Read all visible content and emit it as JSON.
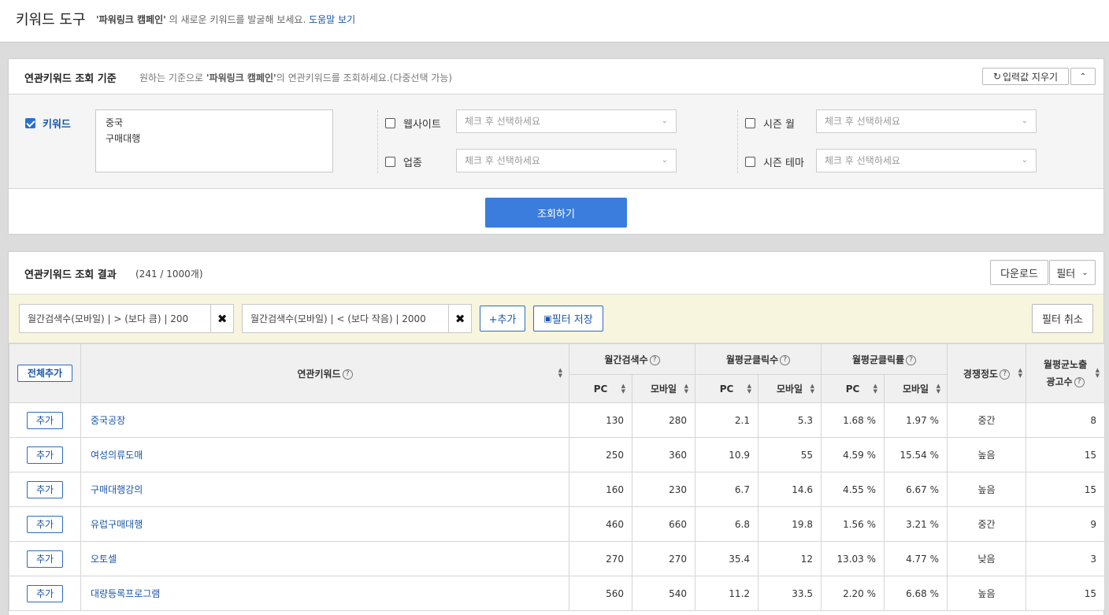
{
  "header": {
    "title": "키워드 도구",
    "desc_campaign": "'파워링크 캠페인'",
    "desc_text": " 의 새로운 키워드를 발굴해 보세요.",
    "help_link": "도움말 보기"
  },
  "criteria": {
    "title": "연관키워드 조회 기준",
    "sub_prefix": "원하는 기준으로 ",
    "sub_campaign": "'파워링크 캠페인'",
    "sub_suffix": "의 연관키워드를 조회하세요.(다중선택 가능)",
    "reset_label": "입력값 지우기",
    "collapse_icon": "chevron-up",
    "keyword_label": "키워드",
    "keyword_checked": true,
    "keywords": [
      "중국",
      "구매대행"
    ],
    "website_label": "웹사이트",
    "industry_label": "업종",
    "season_month_label": "시즌 월",
    "season_theme_label": "시즌 테마",
    "select_placeholder": "체크 후 선택하세요",
    "submit_label": "조회하기"
  },
  "results": {
    "title": "연관키워드 조회 결과",
    "count": "(241 / 1000개)",
    "download_label": "다운로드",
    "filter_label": "필터",
    "filters": [
      "월간검색수(모바일) | > (보다 큼) | 200",
      "월간검색수(모바일) | < (보다 작음) | 2000"
    ],
    "add_filter_label": "+추가",
    "save_filter_label": "필터 저장",
    "cancel_filter_label": "필터 취소",
    "columns": {
      "add_all": "전체추가",
      "keyword": "연관키워드",
      "monthly_search": "월간검색수",
      "avg_clicks": "월평균클릭수",
      "avg_ctr": "월평균클릭률",
      "pc": "PC",
      "mobile": "모바일",
      "competition": "경쟁정도",
      "avg_ads_line1": "월평균노출",
      "avg_ads_line2": "광고수"
    },
    "add_label": "추가",
    "rows": [
      {
        "keyword": "중국공장",
        "search_pc": "130",
        "search_mobile": "280",
        "click_pc": "2.1",
        "click_mobile": "5.3",
        "ctr_pc": "1.68 %",
        "ctr_mobile": "1.97 %",
        "competition": "중간",
        "ads": "8"
      },
      {
        "keyword": "여성의류도매",
        "search_pc": "250",
        "search_mobile": "360",
        "click_pc": "10.9",
        "click_mobile": "55",
        "ctr_pc": "4.59 %",
        "ctr_mobile": "15.54 %",
        "competition": "높음",
        "ads": "15"
      },
      {
        "keyword": "구매대행강의",
        "search_pc": "160",
        "search_mobile": "230",
        "click_pc": "6.7",
        "click_mobile": "14.6",
        "ctr_pc": "4.55 %",
        "ctr_mobile": "6.67 %",
        "competition": "높음",
        "ads": "15"
      },
      {
        "keyword": "유럽구매대행",
        "search_pc": "460",
        "search_mobile": "660",
        "click_pc": "6.8",
        "click_mobile": "19.8",
        "ctr_pc": "1.56 %",
        "ctr_mobile": "3.21 %",
        "competition": "중간",
        "ads": "9"
      },
      {
        "keyword": "오토셀",
        "search_pc": "270",
        "search_mobile": "270",
        "click_pc": "35.4",
        "click_mobile": "12",
        "ctr_pc": "13.03 %",
        "ctr_mobile": "4.77 %",
        "competition": "낮음",
        "ads": "3"
      },
      {
        "keyword": "대량등록프로그램",
        "search_pc": "560",
        "search_mobile": "540",
        "click_pc": "11.2",
        "click_mobile": "33.5",
        "ctr_pc": "2.20 %",
        "ctr_mobile": "6.68 %",
        "competition": "높음",
        "ads": "15"
      }
    ]
  }
}
